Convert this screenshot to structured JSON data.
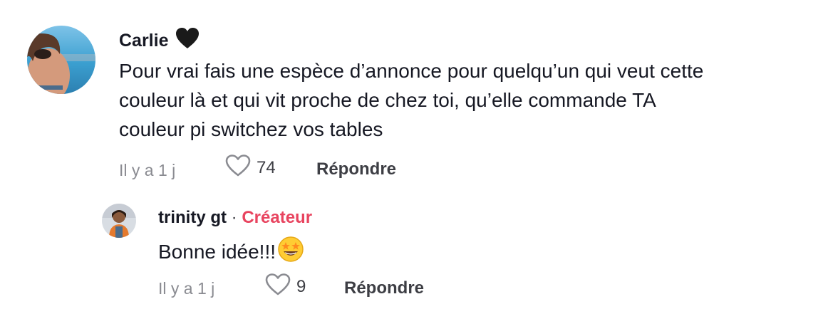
{
  "comments": [
    {
      "author": "Carlie",
      "author_emoji": "black-heart-icon",
      "text_lines": [
        "Pour vrai fais une espèce d’annonce pour quelqu’un qui veut cette",
        "couleur là et qui vit proche de chez toi, qu’elle commande TA",
        "couleur pi switchez vos tables"
      ],
      "time": "Il y a 1 j",
      "likes": "74",
      "reply_label": "Répondre"
    }
  ],
  "replies": [
    {
      "author": "trinity gt",
      "separator": "·",
      "badge": "Créateur",
      "text": "Bonne idée!!!",
      "text_emoji": "star-struck-emoji-icon",
      "time": "Il y a 1 j",
      "likes": "9",
      "reply_label": "Répondre"
    }
  ],
  "colors": {
    "text": "#161823",
    "meta": "#8a8b91",
    "badge": "#e8445f",
    "icon": "#8a8b91"
  }
}
